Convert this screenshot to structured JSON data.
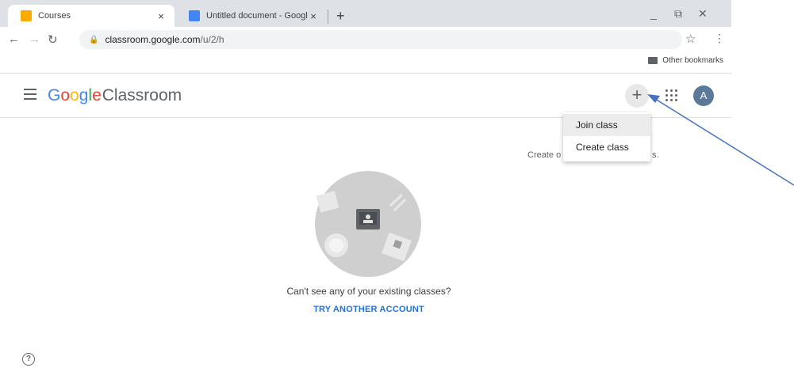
{
  "browser": {
    "tabs": [
      {
        "title": "Courses",
        "favicon_color": "#f9ab00",
        "active": true
      },
      {
        "title": "Untitled document - Google Docs",
        "favicon_color": "#4285f4",
        "active": false
      }
    ],
    "new_tab_label": "+",
    "close_label": "×",
    "url_host": "classroom.google.com",
    "url_path": "/u/2/h",
    "other_bookmarks": "Other bookmarks",
    "window_controls": [
      "_",
      "⧉",
      "✕"
    ]
  },
  "app": {
    "logo_google": [
      "G",
      "o",
      "o",
      "g",
      "l",
      "e"
    ],
    "logo_product": "Classroom",
    "avatar_letter": "A",
    "plus_label": "+"
  },
  "menu": {
    "items": [
      "Join class",
      "Create class"
    ]
  },
  "empty_state": {
    "partial_text_left": "Create o",
    "partial_text_right": "s.",
    "message": "Can't see any of your existing classes?",
    "action": "TRY ANOTHER ACCOUNT"
  },
  "icons": {
    "help": "help-circle-icon",
    "arrow_color": "#4472c4"
  }
}
